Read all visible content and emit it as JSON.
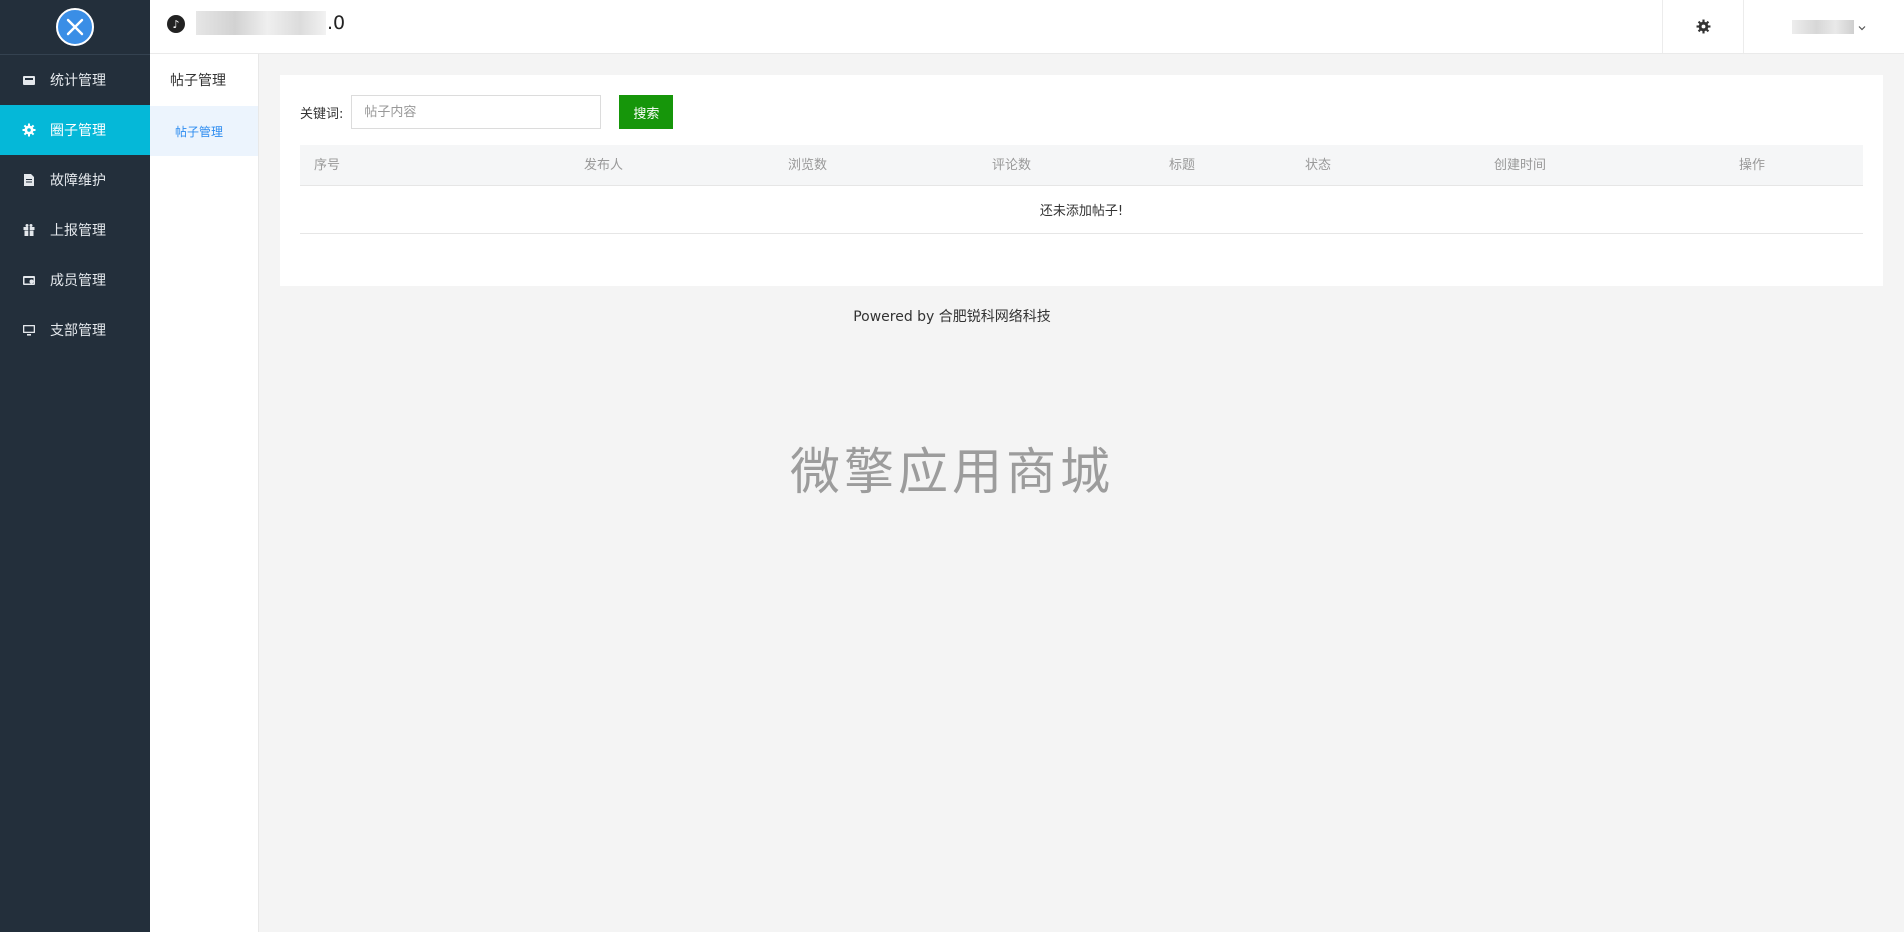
{
  "header": {
    "app_title_suffix": ".0",
    "app_icon_glyph": "♪"
  },
  "sidebar": {
    "items": [
      {
        "label": "统计管理",
        "icon": "chart-icon",
        "active": false
      },
      {
        "label": "圈子管理",
        "icon": "gear-icon",
        "active": true
      },
      {
        "label": "故障维护",
        "icon": "document-icon",
        "active": false
      },
      {
        "label": "上报管理",
        "icon": "gift-icon",
        "active": false
      },
      {
        "label": "成员管理",
        "icon": "member-card-icon",
        "active": false
      },
      {
        "label": "支部管理",
        "icon": "monitor-icon",
        "active": false
      }
    ]
  },
  "subsidebar": {
    "title": "帖子管理",
    "items": [
      {
        "label": "帖子管理",
        "active": true
      }
    ]
  },
  "search": {
    "label": "关键词:",
    "placeholder": "帖子内容",
    "button": "搜索"
  },
  "table": {
    "columns": [
      "序号",
      "发布人",
      "浏览数",
      "评论数",
      "标题",
      "状态",
      "创建时间",
      "操作"
    ],
    "empty_text": "还未添加帖子!"
  },
  "footer": {
    "powered_by": "Powered by 合肥锐科网络科技",
    "watermark": "微擎应用商城"
  },
  "colors": {
    "sidebar_bg": "#232f3b",
    "active_nav": "#05b8d8",
    "search_button": "#16960a",
    "sub_active_text": "#2d8cf0"
  }
}
